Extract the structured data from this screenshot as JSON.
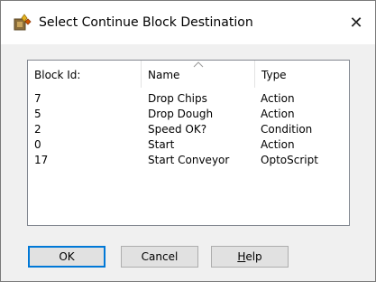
{
  "window": {
    "title": "Select Continue Block Destination",
    "icon": "blocks-app-icon",
    "close_glyph": "✕"
  },
  "list": {
    "columns": [
      "Block Id:",
      "Name",
      "Type"
    ],
    "sorted_column": "Name",
    "rows": [
      {
        "id": "7",
        "name": "Drop Chips",
        "type": "Action"
      },
      {
        "id": "5",
        "name": "Drop Dough",
        "type": "Action"
      },
      {
        "id": "2",
        "name": "Speed OK?",
        "type": "Condition"
      },
      {
        "id": "0",
        "name": "Start",
        "type": "Action"
      },
      {
        "id": "17",
        "name": "Start Conveyor",
        "type": "OptoScript"
      }
    ]
  },
  "buttons": {
    "ok_label": "OK",
    "cancel_label": "Cancel",
    "help_label": "Help",
    "help_mnemonic": "H",
    "help_rest": "elp"
  },
  "colors": {
    "accent": "#0078d7",
    "dialog_bg": "#f0f0f0"
  }
}
